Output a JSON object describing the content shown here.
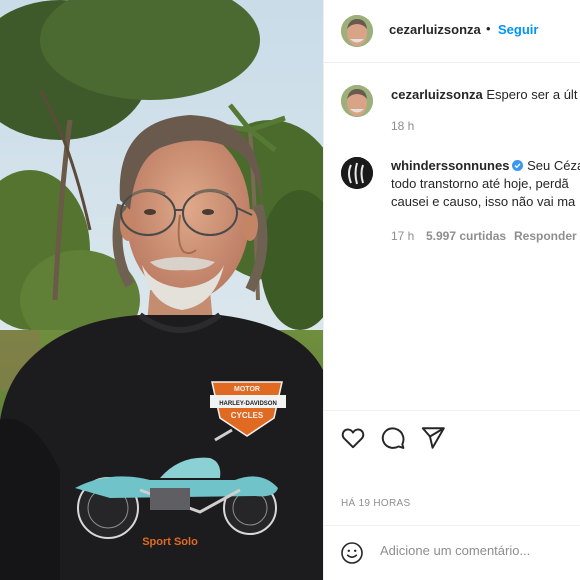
{
  "post": {
    "author": "cezarluizsonza",
    "follow_label": "Seguir",
    "separator": "•",
    "timestamp": "HÁ 19 HORAS",
    "comment_placeholder": "Adicione um comentário..."
  },
  "shirt": {
    "logo_line1": "MOTOR",
    "logo_line2": "HARLEY-DAVIDSON",
    "logo_line3": "CYCLES",
    "print_text": "Sport Solo"
  },
  "comments": [
    {
      "username": "cezarluizsonza",
      "lines": [
        "Espero ser a últ"
      ],
      "time": "18 h",
      "likes": "",
      "reply": "",
      "verified": false
    },
    {
      "username": "whinderssonnunes",
      "lines": [
        "Seu Céza",
        "todo transtorno até hoje, perdã",
        "causei e causo, isso não vai ma"
      ],
      "time": "17 h",
      "likes": "5.997 curtidas",
      "reply": "Responder",
      "verified": true
    }
  ],
  "icons": {
    "like": "heart-icon",
    "comment": "comment-icon",
    "share": "share-icon",
    "emoji": "emoji-icon",
    "verified": "verified-badge-icon"
  }
}
